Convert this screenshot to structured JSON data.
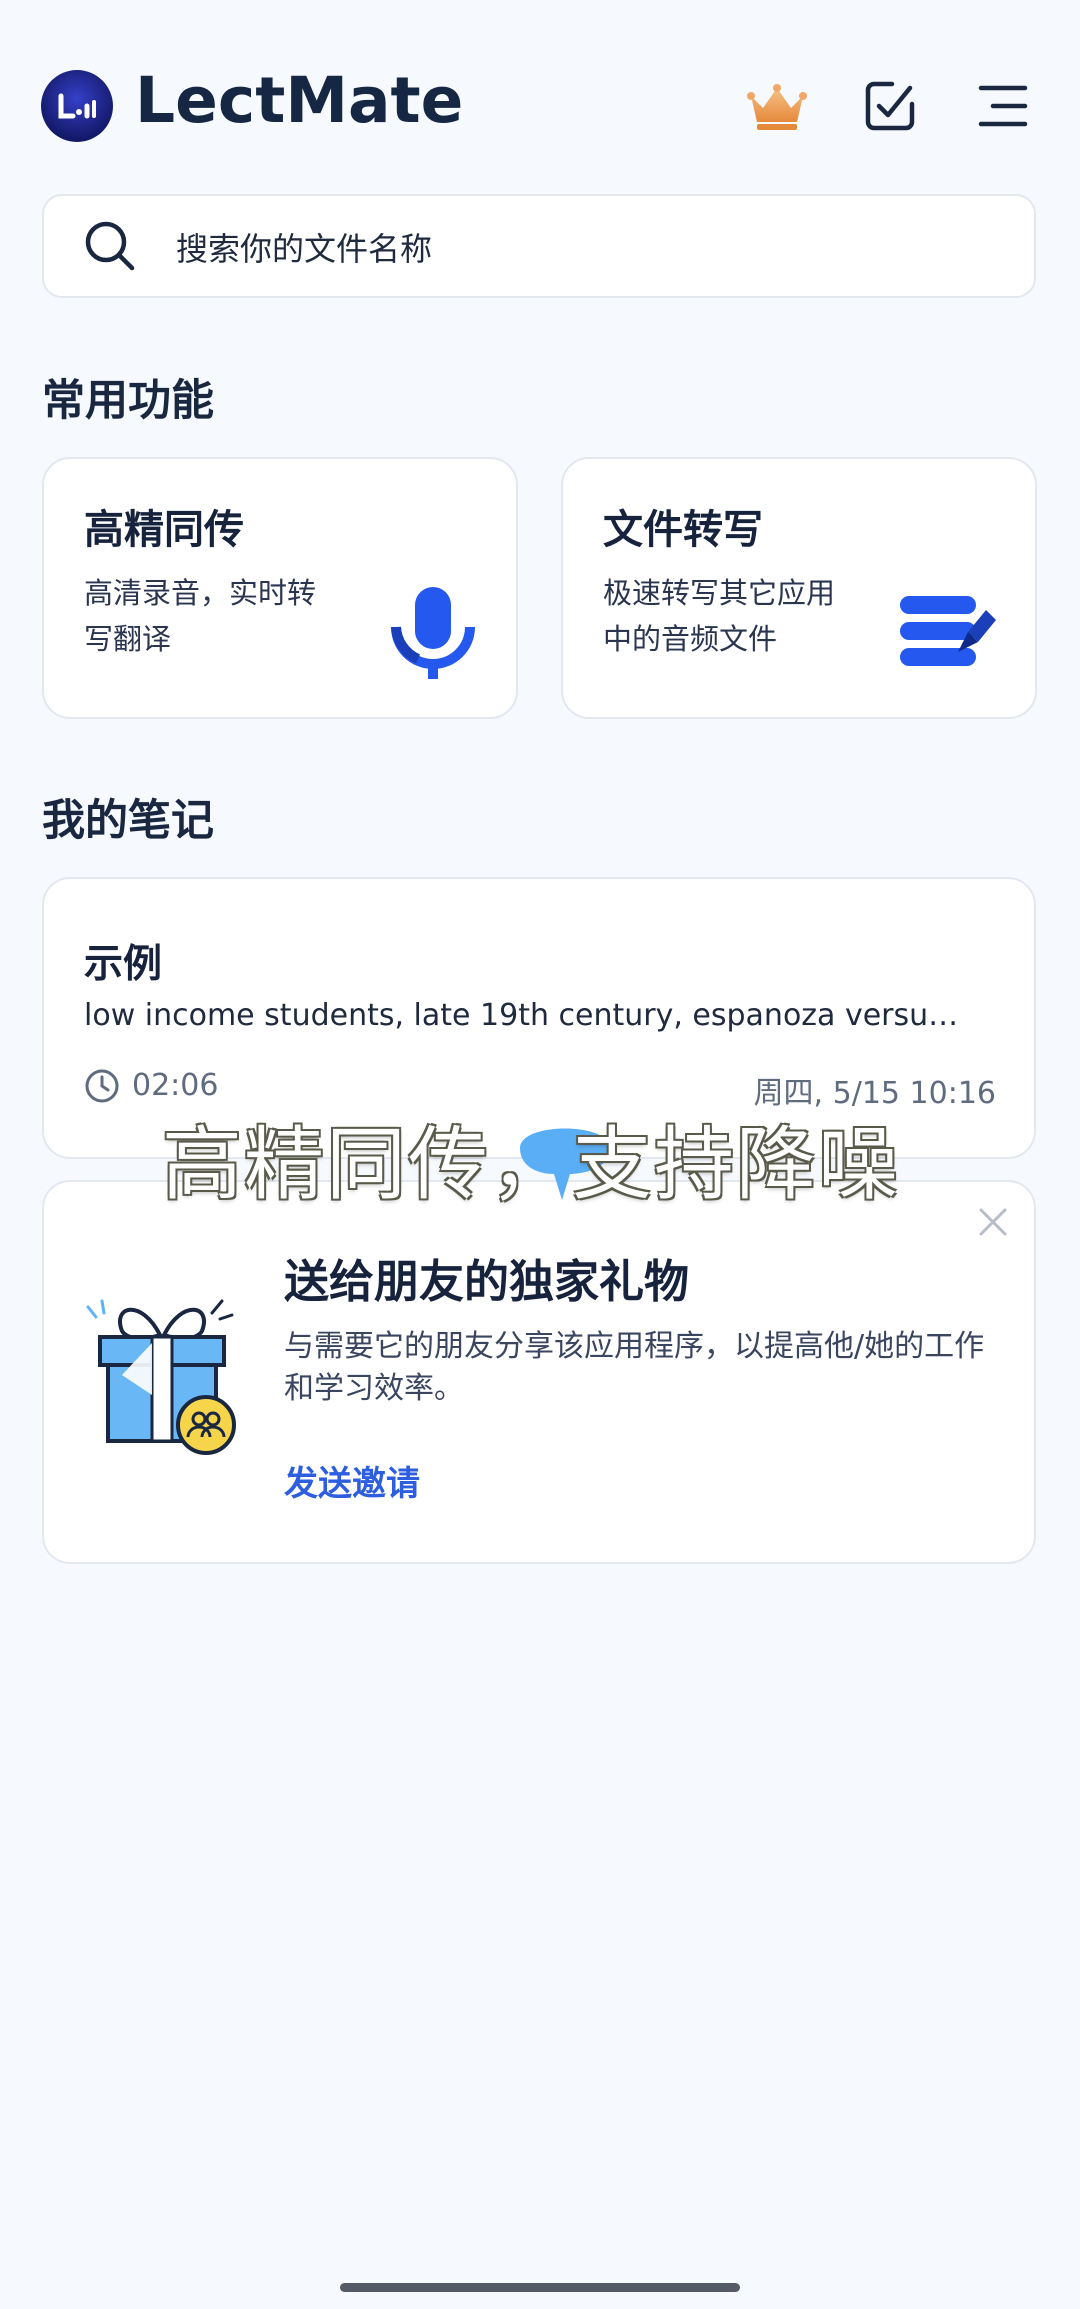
{
  "header": {
    "app_title": "LectMate",
    "icons": [
      "crown-icon",
      "task-check-icon",
      "menu-icon"
    ]
  },
  "search": {
    "placeholder": "搜索你的文件名称"
  },
  "common_features": {
    "title": "常用功能",
    "cards": [
      {
        "title": "高精同传",
        "description_line1": "高清录音，实时转",
        "description_line2": "写翻译",
        "icon": "microphone-icon"
      },
      {
        "title": "文件转写",
        "description_line1": "极速转写其它应用",
        "description_line2": "中的音频文件",
        "icon": "file-transcribe-icon"
      }
    ]
  },
  "my_notes": {
    "title": "我的笔记",
    "items": [
      {
        "title": "示例",
        "snippet": "low income students, late 19th century, espanoza versus...",
        "duration": "02:06",
        "date": "周四, 5/15 10:16"
      }
    ]
  },
  "overlay_caption": "高精同传，支持降噪",
  "invite": {
    "title": "送给朋友的独家礼物",
    "description": "与需要它的朋友分享该应用程序，以提高他/她的工作和学习效率。",
    "link_label": "发送邀请"
  },
  "colors": {
    "background": "#f6f9fd",
    "accent": "#2d5ee0",
    "icon_blue": "#2458ee",
    "crown": "#f0a45a"
  }
}
